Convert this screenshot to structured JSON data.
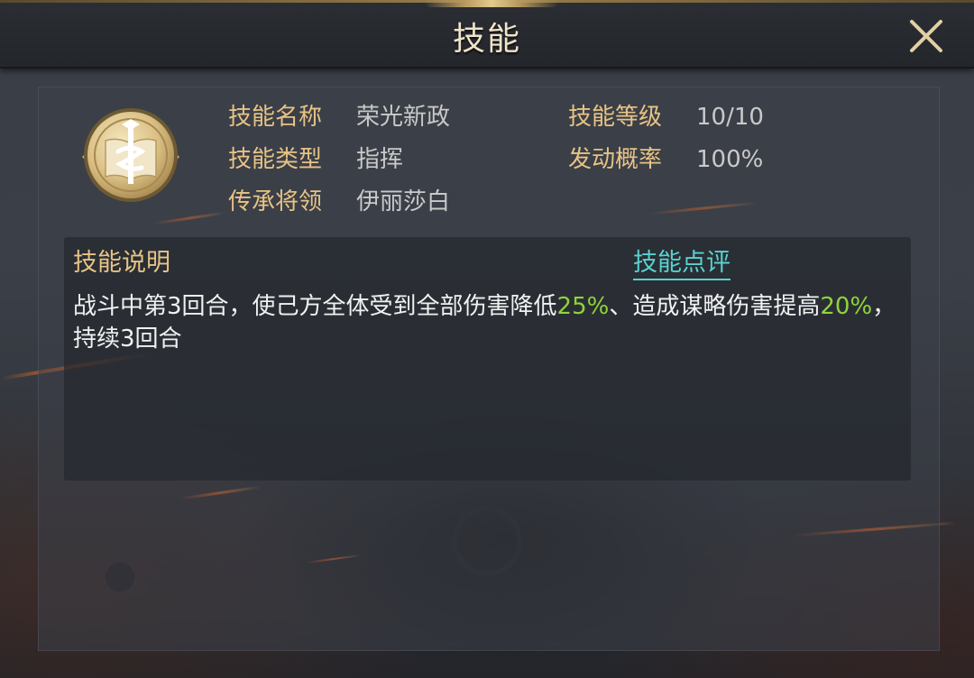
{
  "header": {
    "title": "技能",
    "close_icon": "close-x-icon"
  },
  "skill": {
    "emblem_icon": "scroll-book-emblem-icon",
    "name_label": "技能名称",
    "name_value": "荣光新政",
    "type_label": "技能类型",
    "type_value": "指挥",
    "inherit_label": "传承将领",
    "inherit_value": "伊丽莎白",
    "level_label": "技能等级",
    "level_value": "10/10",
    "chance_label": "发动概率",
    "chance_value": "100%"
  },
  "description": {
    "title": "技能说明",
    "comment_link": "技能点评",
    "text_1": "战斗中第3回合，使己方全体受到全部伤害降低",
    "value_1": "25%",
    "text_2": "、造成谋略伤害提高",
    "value_2": "20%",
    "text_3": "，持续3回合"
  },
  "colors": {
    "label_gold": "#e7c385",
    "value_gray": "#c9c9c9",
    "link_cyan": "#58d2cf",
    "highlight_green": "#8fd43a"
  }
}
